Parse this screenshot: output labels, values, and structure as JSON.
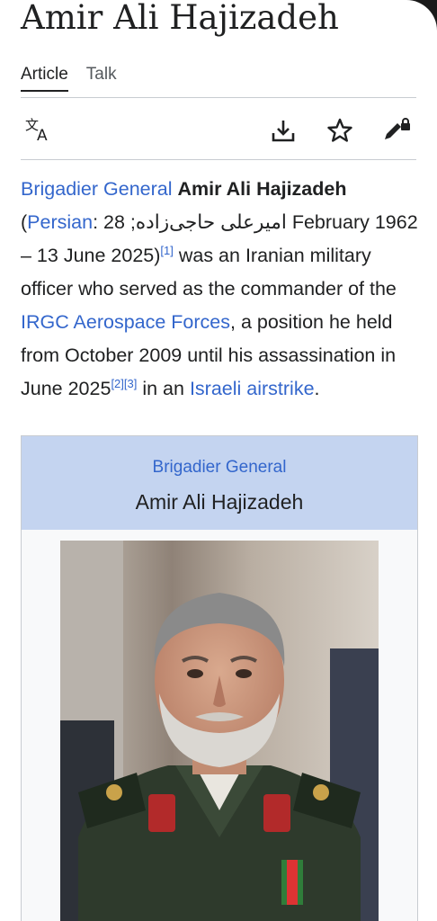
{
  "page": {
    "title": "Amir Ali Hajizadeh"
  },
  "tabs": [
    {
      "label": "Article"
    },
    {
      "label": "Talk"
    }
  ],
  "toolbar": {
    "language_icon": "translate-icon",
    "download_icon": "download-icon",
    "watch_icon": "star-icon",
    "edit_icon": "edit-lock-icon"
  },
  "lead": {
    "rank_link": "Brigadier General",
    "name_bold": "Amir Ali Hajizadeh",
    "open_paren": "(",
    "persian_link": "Persian",
    "persian_text": ": امیرعلی حاجی‌زاده",
    "dates": "; 28 February 1962 – 13 June 2025)",
    "ref1": "[1]",
    "desc1": " was an Iranian military officer who served as the commander of the ",
    "irgc_link": "IRGC Aerospace Forces",
    "desc2": ", a position he held from October 2009 until his assassination in June 2025",
    "ref2": "[2]",
    "ref3": "[3]",
    "desc3": " in an ",
    "airstrike_link": "Israeli airstrike",
    "period": "."
  },
  "infobox": {
    "rank": "Brigadier General",
    "name": "Amir Ali Hajizadeh"
  },
  "colors": {
    "link": "#3366cc",
    "text": "#202122",
    "infobox_header": "#c4d4f0"
  }
}
